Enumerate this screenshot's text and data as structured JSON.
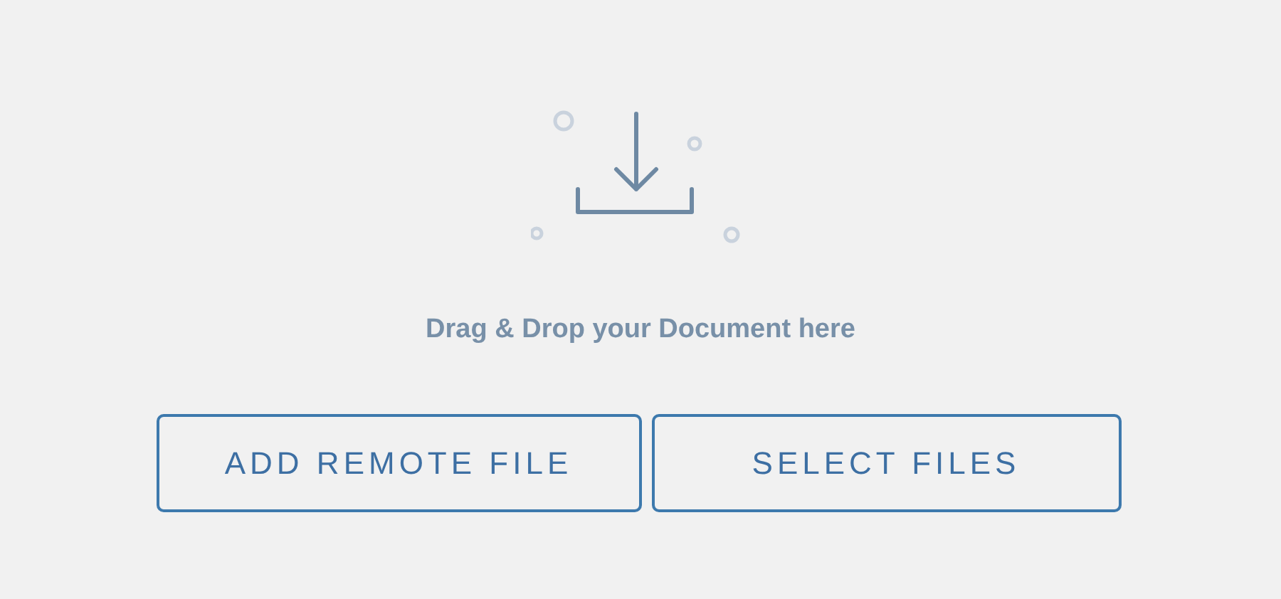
{
  "dropzone": {
    "message": "Drag & Drop your Document here"
  },
  "buttons": [
    {
      "label": "ADD REMOTE FILE"
    },
    {
      "label": "SELECT FILES"
    }
  ]
}
